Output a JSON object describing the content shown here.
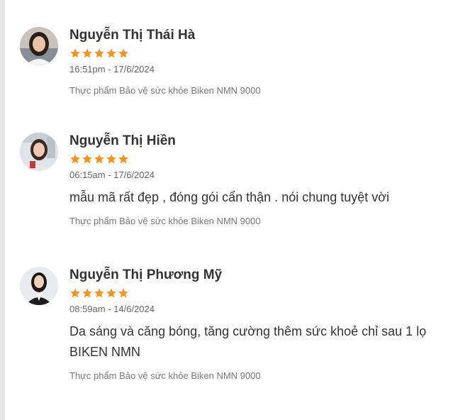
{
  "reviews": [
    {
      "name": "Nguyễn Thị Thái Hà",
      "rating": 5,
      "time": "16:51pm - 17/6/2024",
      "comment": "",
      "product": "Thực phẩm Bảo vệ sức khỏe Biken NMN 9000"
    },
    {
      "name": "Nguyễn Thị Hiền",
      "rating": 5,
      "time": "06:15am - 17/6/2024",
      "comment": "mẫu mã rất đẹp , đóng gói cẩn thận . nói chung tuyệt vời",
      "product": "Thực phẩm Bảo vệ sức khỏe Biken NMN 9000"
    },
    {
      "name": "Nguyễn Thị Phương Mỹ",
      "rating": 5,
      "time": "08:59am - 14/6/2024",
      "comment": "Da sáng và căng bóng, tăng cường thêm sức khoẻ chỉ sau 1 lọ BIKEN NMN",
      "product": "Thực phẩm Bảo vệ sức khỏe Biken NMN 9000"
    }
  ],
  "colors": {
    "star": "#f7931e",
    "text": "#333333",
    "muted": "#777777",
    "rule": "#e6e6e6"
  },
  "icons": {
    "star": "star-icon",
    "avatar": "user-avatar-photo"
  }
}
